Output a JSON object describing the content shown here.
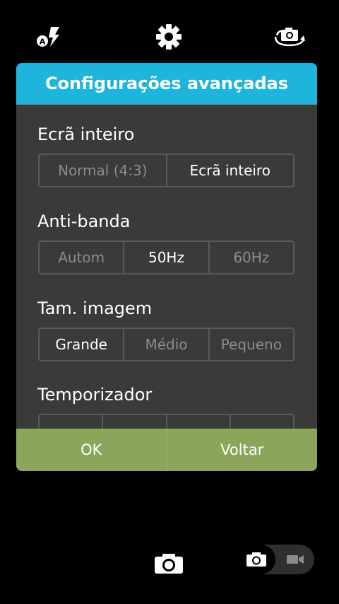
{
  "topbar": {
    "flash_icon": "flash-auto-icon",
    "settings_icon": "gear-icon",
    "switch_camera_icon": "switch-camera-icon"
  },
  "dialog": {
    "title": "Configurações avançadas",
    "header_color": "#1fb4dc",
    "sections": [
      {
        "title": "Ecrã inteiro",
        "options": [
          "Normal (4:3)",
          "Ecrã inteiro"
        ],
        "selected": "Ecrã inteiro"
      },
      {
        "title": "Anti-banda",
        "options": [
          "Autom",
          "50Hz",
          "60Hz"
        ],
        "selected": "50Hz"
      },
      {
        "title": "Tam. imagem",
        "options": [
          "Grande",
          "Médio",
          "Pequeno"
        ],
        "selected": "Grande"
      },
      {
        "title": "Temporizador"
      }
    ],
    "ok_label": "OK",
    "back_label": "Voltar",
    "footer_color": "#8ba55a"
  },
  "bottombar": {
    "shutter_icon": "camera-icon",
    "photo_mode_icon": "photo-mode-icon",
    "video_mode_icon": "video-mode-icon"
  }
}
